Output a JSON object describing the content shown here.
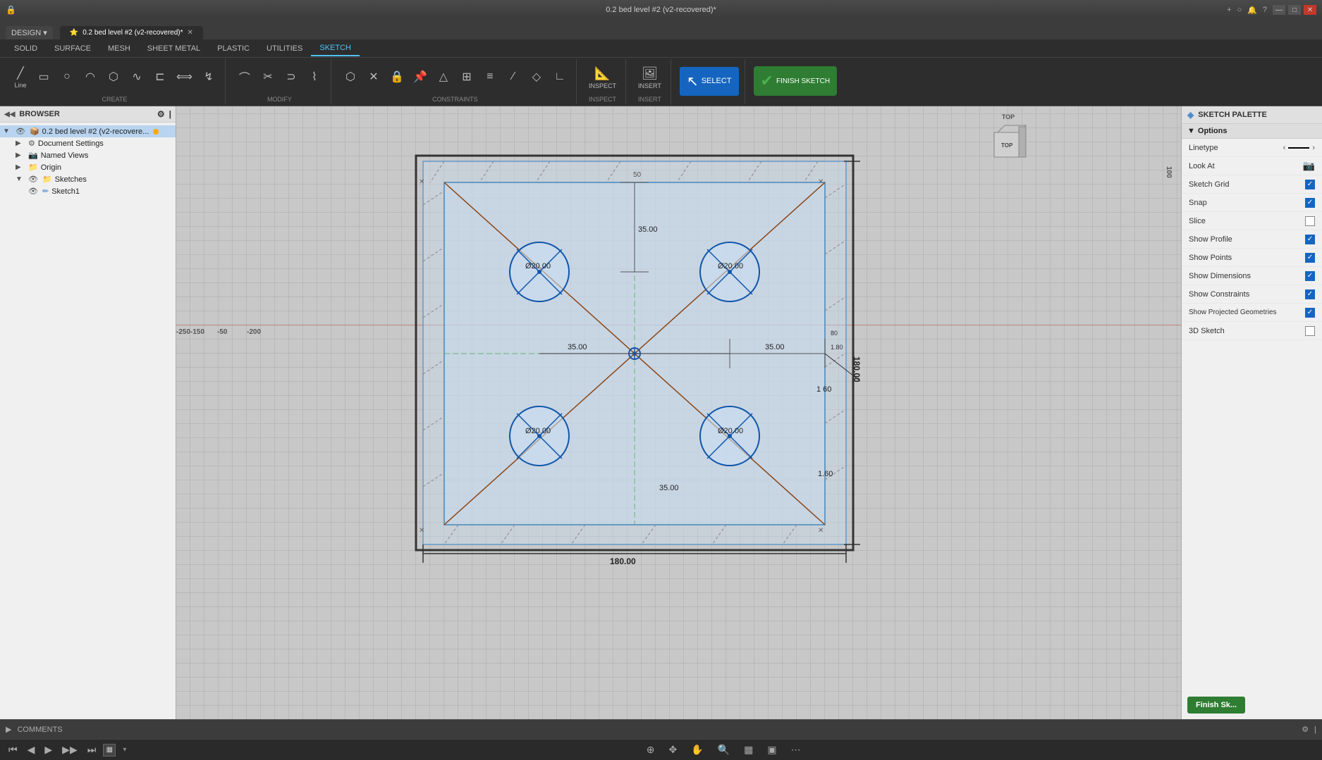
{
  "titlebar": {
    "icon": "🔒",
    "title": "0.2 bed level #2 (v2-recovered)*",
    "controls": [
      "—",
      "□",
      "✕"
    ]
  },
  "window_controls": {
    "minimize": "—",
    "maximize": "□",
    "close": "✕",
    "extra_btns": [
      "+",
      "○",
      "🔔",
      "?"
    ]
  },
  "ribbon": {
    "tabs": [
      "SOLID",
      "SURFACE",
      "MESH",
      "SHEET METAL",
      "PLASTIC",
      "UTILITIES",
      "SKETCH"
    ],
    "active_tab": "SKETCH",
    "design_btn": "DESIGN ▾",
    "groups": {
      "create": {
        "label": "CREATE",
        "tools": [
          "line",
          "rectangle",
          "circle-3pt",
          "arc",
          "polygon",
          "spline",
          "conic",
          "offset",
          "mirror",
          "project"
        ]
      },
      "modify": {
        "label": "MODIFY",
        "tools": [
          "fillet",
          "trim",
          "extend",
          "break",
          "offset-geom",
          "scale"
        ]
      },
      "constraints": {
        "label": "CONSTRAINTS",
        "tools": [
          "coincident",
          "collinear",
          "concentric",
          "midpoint",
          "fix",
          "horizontal",
          "vertical",
          "tangent",
          "equal",
          "parallel",
          "perpendicular",
          "smooth"
        ]
      },
      "inspect": {
        "label": "INSPECT",
        "tools": [
          "measure"
        ]
      },
      "insert": {
        "label": "INSERT",
        "tools": [
          "image",
          "dxf"
        ]
      },
      "select": {
        "label": "SELECT",
        "active": true
      },
      "finish": {
        "label": "FINISH SKETCH",
        "active": true
      }
    }
  },
  "browser": {
    "title": "BROWSER",
    "items": [
      {
        "id": "root",
        "label": "0.2 bed level #2 (v2-recovere...",
        "level": 0,
        "expanded": true,
        "type": "root",
        "active": true
      },
      {
        "id": "doc-settings",
        "label": "Document Settings",
        "level": 1,
        "expanded": false,
        "type": "settings"
      },
      {
        "id": "named-views",
        "label": "Named Views",
        "level": 1,
        "expanded": false,
        "type": "views"
      },
      {
        "id": "origin",
        "label": "Origin",
        "level": 1,
        "expanded": false,
        "type": "origin"
      },
      {
        "id": "sketches",
        "label": "Sketches",
        "level": 1,
        "expanded": true,
        "type": "sketches"
      },
      {
        "id": "sketch1",
        "label": "Sketch1",
        "level": 2,
        "expanded": false,
        "type": "sketch",
        "visible": true
      }
    ]
  },
  "viewport": {
    "background": "#c8c8c8",
    "view_cube_label": "TOP",
    "axis_labels": {
      "x": "",
      "y": ""
    }
  },
  "sketch": {
    "dimensions": {
      "outer_size": "180.00",
      "circle_diameter": "Ø20.00",
      "dim_35": "35.00",
      "dim_50": "-50",
      "dim_100": "100",
      "dim_180_00": "180.00",
      "dim_160": "1 60",
      "dim_35_right": "35.00",
      "dim_160b": "1.60",
      "dim_80": "1.80.00"
    }
  },
  "sketch_palette": {
    "title": "SKETCH PALETTE",
    "section_options": "Options",
    "rows": [
      {
        "id": "linetype",
        "label": "Linetype",
        "control": "arrows",
        "checked": null
      },
      {
        "id": "look-at",
        "label": "Look At",
        "control": "button",
        "checked": null
      },
      {
        "id": "sketch-grid",
        "label": "Sketch Grid",
        "control": "checkbox",
        "checked": true
      },
      {
        "id": "snap",
        "label": "Snap",
        "control": "checkbox",
        "checked": true
      },
      {
        "id": "slice",
        "label": "Slice",
        "control": "checkbox",
        "checked": false
      },
      {
        "id": "show-profile",
        "label": "Show Profile",
        "control": "checkbox",
        "checked": true
      },
      {
        "id": "show-points",
        "label": "Show Points",
        "control": "checkbox",
        "checked": true
      },
      {
        "id": "show-dimensions",
        "label": "Show Dimensions",
        "control": "checkbox",
        "checked": true
      },
      {
        "id": "show-constraints",
        "label": "Show Constraints",
        "control": "checkbox",
        "checked": true
      },
      {
        "id": "show-projected",
        "label": "Show Projected Geometries",
        "control": "checkbox",
        "checked": true
      },
      {
        "id": "3d-sketch",
        "label": "3D Sketch",
        "control": "checkbox",
        "checked": false
      }
    ],
    "finish_btn": "Finish Sk..."
  },
  "comments": {
    "label": "COMMENTS"
  },
  "bottom_toolbar": {
    "nav_buttons": [
      "⏮",
      "◀",
      "▶",
      "▶▶",
      "⏭"
    ],
    "selection_filter_icon": "▦",
    "view_tools": [
      "⊕",
      "✥",
      "✋",
      "⊞",
      "🔍",
      "⊟",
      "▦",
      "▣",
      "⋯"
    ]
  }
}
